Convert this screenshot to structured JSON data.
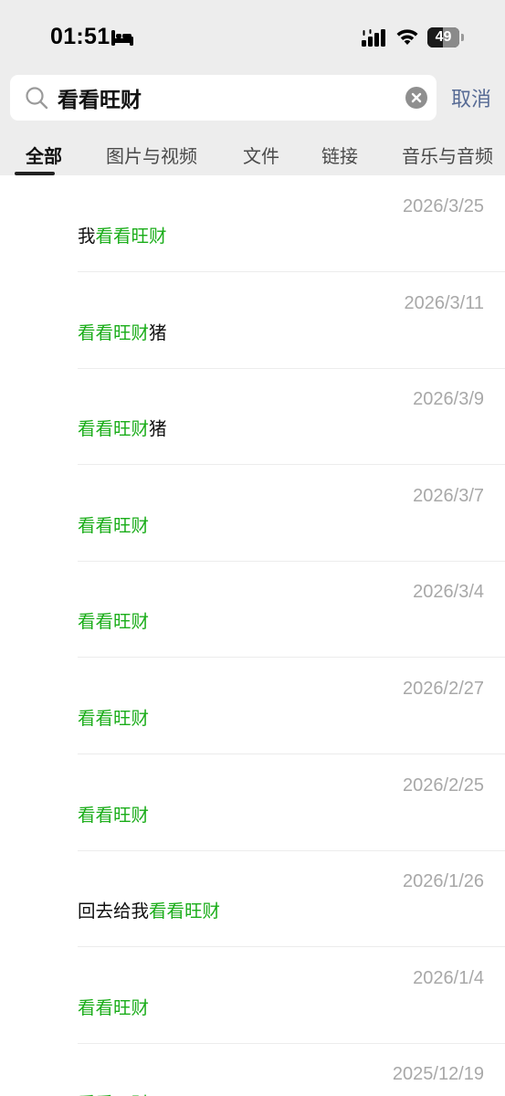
{
  "status_bar": {
    "time": "01:51",
    "battery_level": "49",
    "battery_fraction": 0.49,
    "icons": [
      "sleep-icon",
      "signal-icon",
      "wifi-icon",
      "battery-icon"
    ]
  },
  "search": {
    "query": "看看旺财",
    "cancel_label": "取消",
    "icons": [
      "search-icon",
      "clear-icon"
    ]
  },
  "tabs": [
    {
      "label": "全部",
      "active": true
    },
    {
      "label": "图片与视频",
      "active": false
    },
    {
      "label": "文件",
      "active": false
    },
    {
      "label": "链接",
      "active": false
    },
    {
      "label": "音乐与音频",
      "active": false
    }
  ],
  "results": [
    {
      "date": "2026/3/25",
      "pre": "我",
      "match": "看看旺财",
      "post": ""
    },
    {
      "date": "2026/3/11",
      "pre": "",
      "match": "看看旺财",
      "post": "猪"
    },
    {
      "date": "2026/3/9",
      "pre": "",
      "match": "看看旺财",
      "post": "猪"
    },
    {
      "date": "2026/3/7",
      "pre": "",
      "match": "看看旺财",
      "post": ""
    },
    {
      "date": "2026/3/4",
      "pre": "",
      "match": "看看旺财",
      "post": ""
    },
    {
      "date": "2026/2/27",
      "pre": "",
      "match": "看看旺财",
      "post": ""
    },
    {
      "date": "2026/2/25",
      "pre": "",
      "match": "看看旺财",
      "post": ""
    },
    {
      "date": "2026/1/26",
      "pre": "回去给我",
      "match": "看看旺财",
      "post": ""
    },
    {
      "date": "2026/1/4",
      "pre": "",
      "match": "看看旺财",
      "post": ""
    },
    {
      "date": "2025/12/19",
      "pre": "",
      "match": "看看旺财",
      "post": ""
    }
  ],
  "colors": {
    "highlight": "#1aad19",
    "link": "#576b95",
    "date": "#a8a8a8",
    "header_bg": "#ededed"
  }
}
